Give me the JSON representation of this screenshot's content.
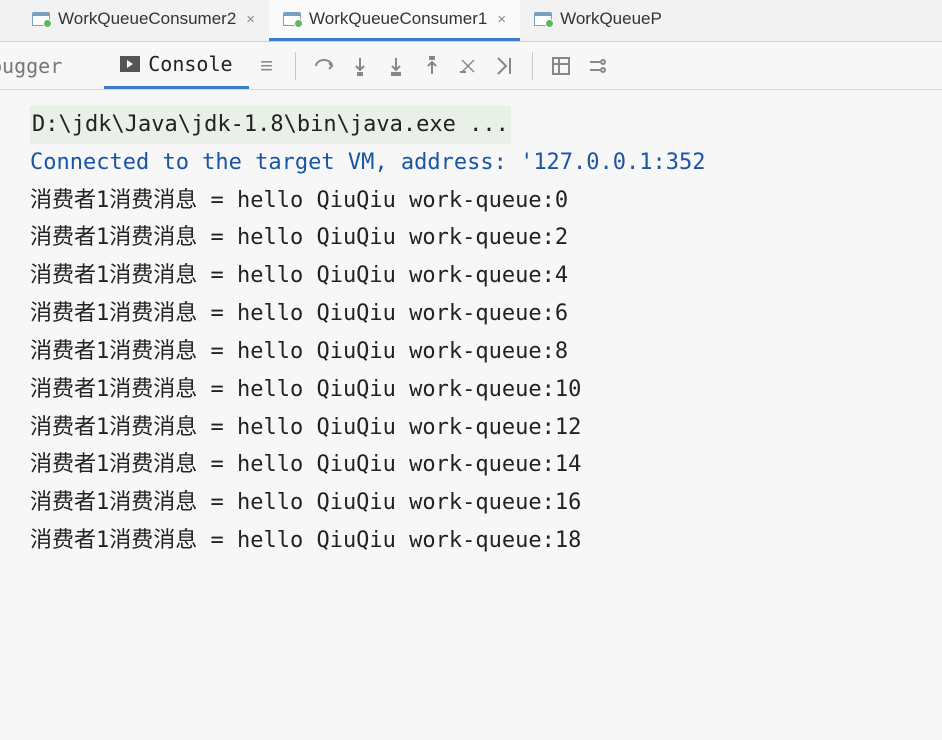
{
  "tabs": [
    {
      "label": "WorkQueueConsumer2",
      "active": false
    },
    {
      "label": "WorkQueueConsumer1",
      "active": true
    },
    {
      "label": "WorkQueueP",
      "active": false
    }
  ],
  "toolbar": {
    "debugger_label": "bugger",
    "console_label": "Console"
  },
  "console": {
    "command": "D:\\jdk\\Java\\jdk-1.8\\bin\\java.exe ...",
    "connected": "Connected to the target VM, address: '127.0.0.1:352",
    "output_prefix": "消费者1消费消息 = hello QiuQiu work-queue:",
    "output_values": [
      0,
      2,
      4,
      6,
      8,
      10,
      12,
      14,
      16,
      18
    ]
  }
}
